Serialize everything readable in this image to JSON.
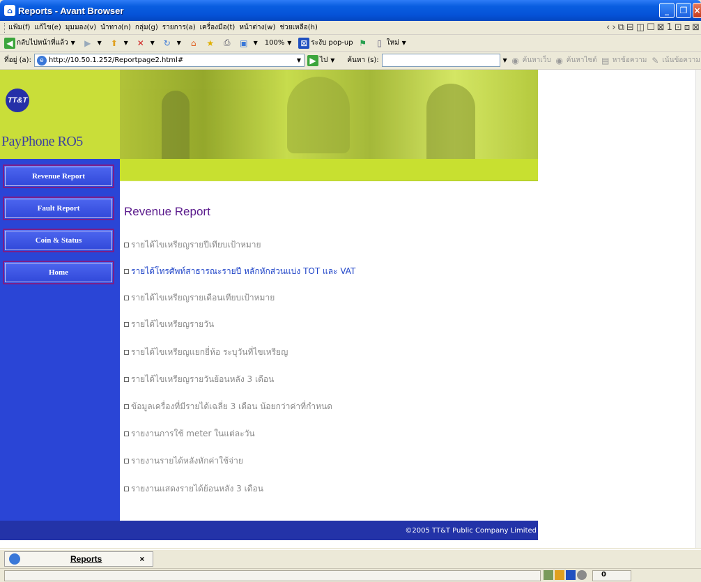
{
  "window": {
    "title": "Reports - Avant Browser"
  },
  "menu": [
    "แฟ้ม(f)",
    "แก้ไข(e)",
    "มุมมอง(v)",
    "นำทาง(n)",
    "กลุ่ม(g)",
    "รายการ(a)",
    "เครื่องมือ(t)",
    "หน้าต่าง(w)",
    "ช่วยเหลือ(h)"
  ],
  "toolbar": {
    "back_label": "กลับไปหน้าที่แล้ว",
    "zoom": "100%",
    "popup_label": "ระงับ pop-up",
    "new_label": "ใหม่"
  },
  "address": {
    "label": "ที่อยู่ (a):",
    "url": "http://10.50.1.252/Reportpage2.html#",
    "go_label": "ไป",
    "search_label": "ค้นหา (s):",
    "search_value": "",
    "web_search": "ค้นหาเว็บ",
    "site_search": "ค้นหาไซต์",
    "find_text": "หาข้อความ",
    "highlight": "เน้นข้อความ"
  },
  "site": {
    "logo_badge": "TT&T",
    "logo_text": "PayPhone RO5",
    "nav": [
      "Revenue Report",
      "Fault Report",
      "Coin & Status",
      "Home"
    ],
    "heading": "Revenue Report",
    "reports": [
      "รายได้ไขเหรียญรายปีเทียบเป้าหมาย",
      "รายได้โทรศัพท์สาธารณะรายปี หลักหักส่วนแบ่ง TOT และ VAT",
      "รายได้ไขเหรียญรายเดือนเทียบเป้าหมาย",
      "รายได้ไขเหรียญรายวัน",
      "รายได้ไขเหรียญแยกยี่ห้อ ระบุวันที่ไขเหรียญ",
      "รายได้ไขเหรียญรายวันย้อนหลัง 3 เดือน",
      "ข้อมูลเครื่องที่มีรายได้เฉลี่ย 3 เดือน น้อยกว่าค่าที่กำหนด",
      "รายงานการใช้ meter ในแต่ละวัน",
      "รายงานรายได้หลังหักค่าใช้จ่าย",
      "รายงานแสดงรายได้ย้อนหลัง 3 เดือน"
    ],
    "footer": "©2005 TT&T Public Company Limited"
  },
  "tabs": [
    {
      "label": "Reports",
      "close": "×"
    }
  ],
  "status": {
    "counter": "0"
  }
}
